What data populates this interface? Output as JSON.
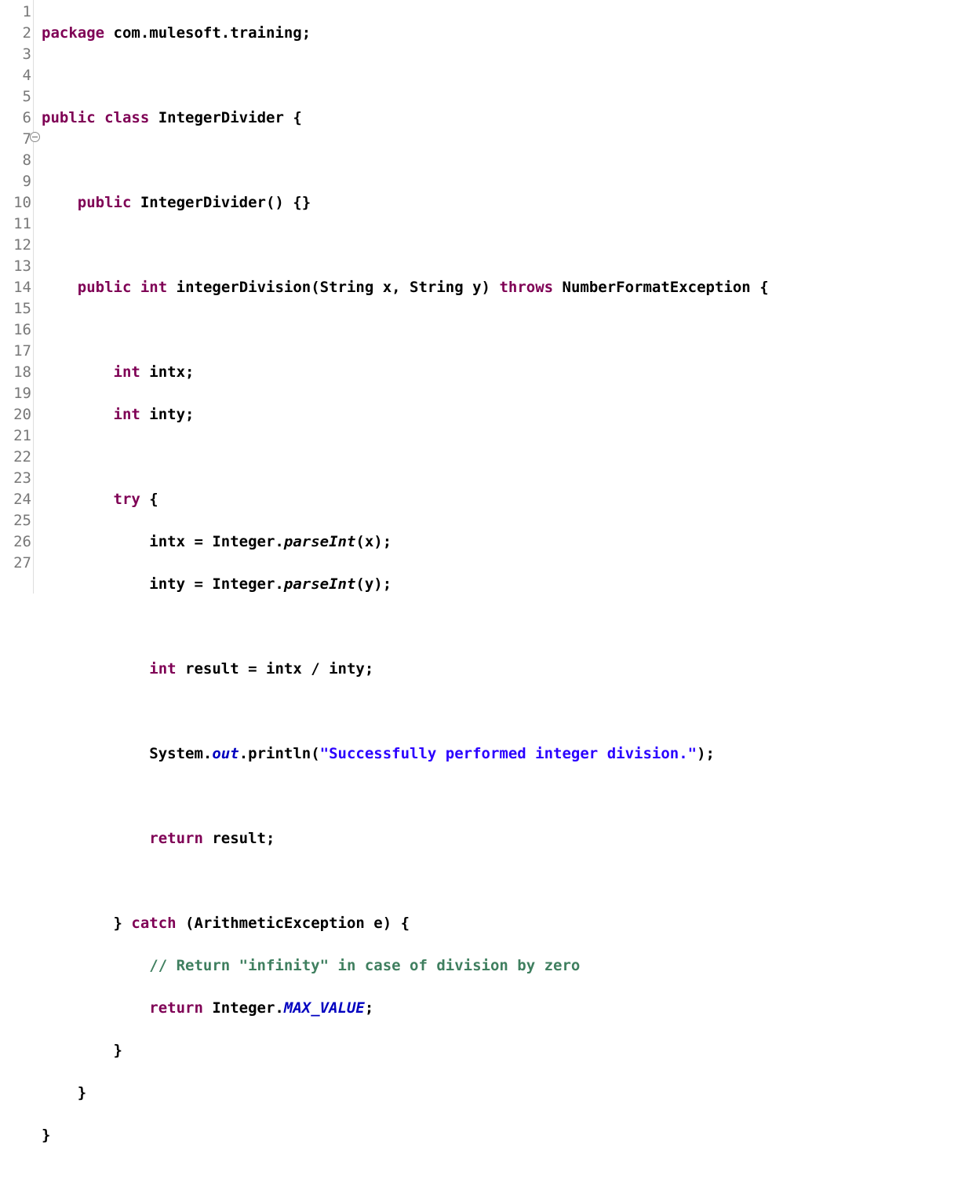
{
  "gutter": {
    "lines": [
      "1",
      "2",
      "3",
      "4",
      "5",
      "6",
      "7",
      "8",
      "9",
      "10",
      "11",
      "12",
      "13",
      "14",
      "15",
      "16",
      "17",
      "18",
      "19",
      "20",
      "21",
      "22",
      "23",
      "24",
      "25",
      "26",
      "27"
    ],
    "fold_at": 7
  },
  "tok": {
    "l1": {
      "kw_package": "package",
      "pkg": " com.mulesoft.training;"
    },
    "l3": {
      "kw_public": "public",
      "kw_class": "class",
      "name": " IntegerDivider ",
      "brace": "{"
    },
    "l5": {
      "kw_public": "public",
      "ctor": " IntegerDivider() {}"
    },
    "l7": {
      "kw_public": "public",
      "kw_int": "int",
      "name": " integerDivision(String x, String y) ",
      "kw_throws": "throws",
      "exc": " NumberFormatException ",
      "brace": "{"
    },
    "l9": {
      "kw_int": "int",
      "rest": " intx;"
    },
    "l10": {
      "kw_int": "int",
      "rest": " inty;"
    },
    "l12": {
      "kw_try": "try",
      "rest": " {"
    },
    "l13": {
      "pre": "intx = Integer.",
      "meth": "parseInt",
      "post": "(x);"
    },
    "l14": {
      "pre": "inty = Integer.",
      "meth": "parseInt",
      "post": "(y);"
    },
    "l16": {
      "kw_int": "int",
      "rest": " result = intx / inty;"
    },
    "l18": {
      "pre": "System.",
      "field": "out",
      "mid": ".println(",
      "str": "\"Successfully performed integer division.\"",
      "post": ");"
    },
    "l20": {
      "kw_return": "return",
      "rest": " result;"
    },
    "l22": {
      "close": "} ",
      "kw_catch": "catch",
      "rest": " (ArithmeticException e) {"
    },
    "l23": {
      "cmt": "// Return \"infinity\" in case of division by zero"
    },
    "l24": {
      "kw_return": "return",
      "mid": " Integer.",
      "const": "MAX_VALUE",
      "post": ";"
    },
    "l25": {
      "txt": "}"
    },
    "l26": {
      "txt": "}"
    },
    "l27": {
      "txt": "}"
    }
  }
}
